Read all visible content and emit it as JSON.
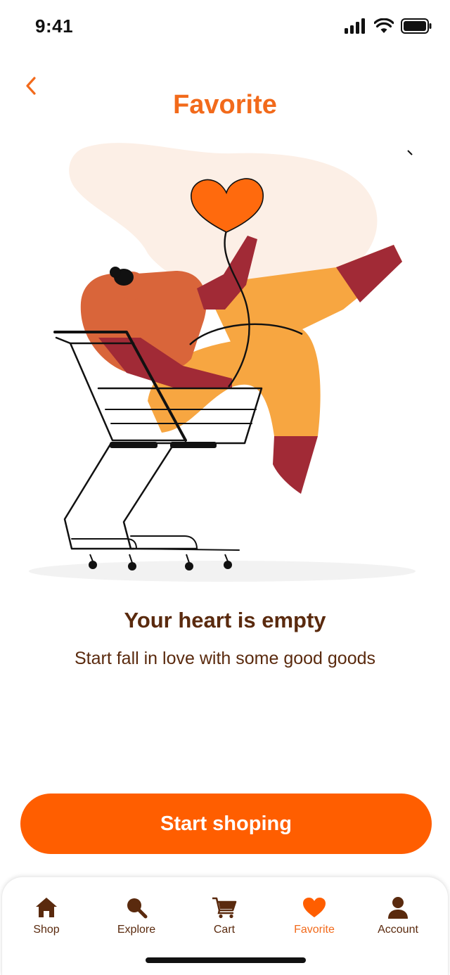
{
  "status_bar": {
    "time": "9:41",
    "signal_icon": "cellular-signal-icon",
    "wifi_icon": "wifi-icon",
    "battery_icon": "battery-icon"
  },
  "header": {
    "back_icon": "chevron-left-icon",
    "title": "Favorite"
  },
  "empty_state": {
    "title": "Your heart is empty",
    "subtitle": "Start fall in love with some good goods"
  },
  "cta": {
    "label": "Start shoping"
  },
  "tab_bar": {
    "active": "Favorite",
    "items": [
      {
        "label": "Shop",
        "icon": "home-icon"
      },
      {
        "label": "Explore",
        "icon": "search-icon"
      },
      {
        "label": "Cart",
        "icon": "cart-icon"
      },
      {
        "label": "Favorite",
        "icon": "heart-icon"
      },
      {
        "label": "Account",
        "icon": "user-icon"
      }
    ]
  },
  "colors": {
    "accent": "#FF5E00",
    "title_orange": "#F26A1B",
    "text_brown": "#5A2A0E",
    "blob": "#FCEFE6"
  }
}
